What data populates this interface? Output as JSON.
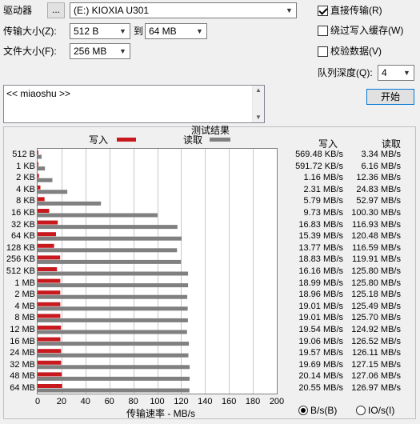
{
  "controls": {
    "drive_label": "驱动器",
    "browse_button": "...",
    "drive_value": "(E:) KIOXIA U301",
    "transfer_size_label": "传输大小(Z):",
    "transfer_from": "512 B",
    "to_label": "到",
    "transfer_to": "64 MB",
    "file_size_label": "文件大小(F):",
    "file_size": "256 MB",
    "direct_transfer": {
      "label": "直接传输(R)",
      "checked": true
    },
    "bypass_cache": {
      "label": "绕过写入缓存(W)",
      "checked": false
    },
    "verify_data": {
      "label": "校验数据(V)",
      "checked": false
    },
    "queue_depth_label": "队列深度(Q):",
    "queue_depth": "4",
    "start_button": "开始"
  },
  "description": {
    "text": "<< miaoshu >>"
  },
  "results": {
    "title": "测试结果",
    "write_col": "写入",
    "read_col": "读取",
    "legend_write": "写入",
    "legend_read": "读取",
    "xlabel": "传输速率 - MB/s",
    "unit_bs": "B/s(B)",
    "unit_ios": "IO/s(I)",
    "unit_selected": "B/s(B)"
  },
  "colors": {
    "write": "#c8191e",
    "read": "#808080"
  },
  "chart_data": {
    "type": "bar",
    "orientation": "horizontal",
    "title": "测试结果",
    "xlabel": "传输速率 - MB/s",
    "ylabel": "",
    "xlim": [
      0,
      200
    ],
    "xticks": [
      0,
      20,
      40,
      60,
      80,
      100,
      120,
      140,
      160,
      180,
      200
    ],
    "grid": true,
    "legend_position": "top",
    "categories": [
      "512 B",
      "1 KB",
      "2 KB",
      "4 KB",
      "8 KB",
      "16 KB",
      "32 KB",
      "64 KB",
      "128 KB",
      "256 KB",
      "512 KB",
      "1 MB",
      "2 MB",
      "4 MB",
      "8 MB",
      "12 MB",
      "16 MB",
      "24 MB",
      "32 MB",
      "48 MB",
      "64 MB"
    ],
    "series": [
      {
        "name": "写入",
        "values": [
          0.57,
          0.58,
          1.16,
          2.31,
          5.79,
          9.73,
          16.83,
          15.39,
          13.77,
          18.83,
          16.16,
          18.99,
          18.96,
          19.01,
          19.01,
          19.54,
          19.06,
          19.57,
          19.69,
          20.14,
          20.55
        ],
        "labels": [
          "569.48 KB/s",
          "591.72 KB/s",
          "1.16 MB/s",
          "2.31 MB/s",
          "5.79 MB/s",
          "9.73 MB/s",
          "16.83 MB/s",
          "15.39 MB/s",
          "13.77 MB/s",
          "18.83 MB/s",
          "16.16 MB/s",
          "18.99 MB/s",
          "18.96 MB/s",
          "19.01 MB/s",
          "19.01 MB/s",
          "19.54 MB/s",
          "19.06 MB/s",
          "19.57 MB/s",
          "19.69 MB/s",
          "20.14 MB/s",
          "20.55 MB/s"
        ]
      },
      {
        "name": "读取",
        "values": [
          3.34,
          6.16,
          12.36,
          24.83,
          52.97,
          100.3,
          116.93,
          120.48,
          116.59,
          119.91,
          125.8,
          125.8,
          125.18,
          125.49,
          125.7,
          124.92,
          126.52,
          126.11,
          127.15,
          127.06,
          126.97
        ],
        "labels": [
          "3.34 MB/s",
          "6.16 MB/s",
          "12.36 MB/s",
          "24.83 MB/s",
          "52.97 MB/s",
          "100.30 MB/s",
          "116.93 MB/s",
          "120.48 MB/s",
          "116.59 MB/s",
          "119.91 MB/s",
          "125.80 MB/s",
          "125.80 MB/s",
          "125.18 MB/s",
          "125.49 MB/s",
          "125.70 MB/s",
          "124.92 MB/s",
          "126.52 MB/s",
          "126.11 MB/s",
          "127.15 MB/s",
          "127.06 MB/s",
          "126.97 MB/s"
        ]
      }
    ]
  }
}
